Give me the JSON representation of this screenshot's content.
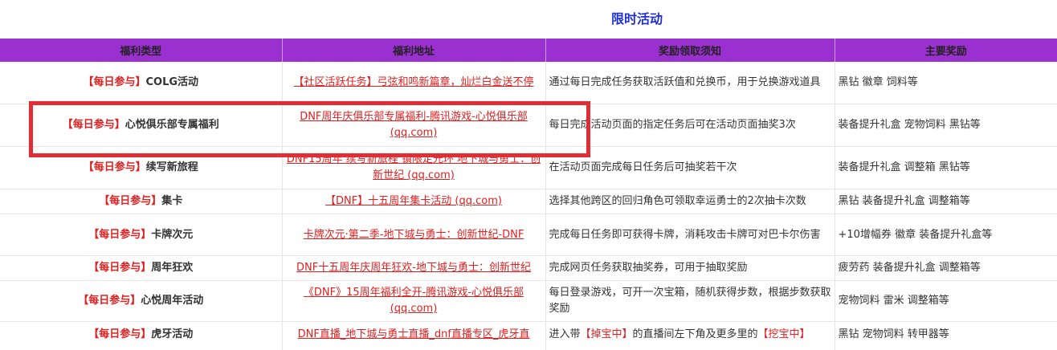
{
  "page": {
    "title": "限时活动"
  },
  "columns": [
    "福利类型",
    "福利地址",
    "奖励领取须知",
    "主要奖励"
  ],
  "rows": [
    {
      "tag": "【每日参与】",
      "type": "COLG活动",
      "link": "【社区活跃任务】弓弦和鸣新篇章，灿烂白金送不停",
      "notes": "通过每日完成任务获取活跃值和兑换币，用于兑换游戏道具",
      "rewards": "黑钻 徽章 饲料等"
    },
    {
      "tag": "【每日参与】",
      "type": "心悦俱乐部专属福利",
      "link": "DNF周年庆俱乐部专属福利-腾讯游戏-心悦俱乐部 (qq.com)",
      "notes": "每日完成活动页面的指定任务后可在活动页面抽奖3次",
      "rewards": "装备提升礼盒 宠物饲料 黑钻等"
    },
    {
      "tag": "【每日参与】",
      "type": "续写新旅程",
      "link": "DNF15周年 续写新旅程 镇限定光环 地下城与勇士：创新世纪 (qq.com)",
      "notes": "在活动页面完成每日任务后可抽奖若干次",
      "rewards": "装备提升礼盒 调整箱 黑钻等"
    },
    {
      "tag": "【每日参与】",
      "type": "集卡",
      "link": "【DNF】十五周年集卡活动 (qq.com)",
      "notes": "选择其他跨区的回归角色可领取幸运勇士的2次抽卡次数",
      "rewards": "黑钻 装备提升礼盒 调整箱等"
    },
    {
      "tag": "【每日参与】",
      "type": "卡牌次元",
      "link": "卡牌次元·第二季-地下城与勇士：创新世纪-DNF",
      "notes": "完成每日任务即可获得卡牌，消耗攻击卡牌可对巴卡尔伤害",
      "rewards": "+10增幅券 徽章 装备提升礼盒等"
    },
    {
      "tag": "【每日参与】",
      "type": "周年狂欢",
      "link": "DNF十五周年庆周年狂欢-地下城与勇士：创新世纪",
      "notes": "完成网页任务获取抽奖券，可用于抽取奖励",
      "rewards": "疲劳药 装备提升礼盒 调整箱等"
    },
    {
      "tag": "【每日参与】",
      "type": "心悦周年活动",
      "link": "《DNF》15周年福利全开-腾讯游戏-心悦俱乐部 (qq.com)",
      "notes": "每日登录游戏，可开一次宝箱，随机获得步数，根据步数获取奖励",
      "rewards": "宠物饲料 雷米 调整箱等"
    },
    {
      "tag": "【每日参与】",
      "type": "虎牙活动",
      "link": "DNF直播_地下城与勇士直播_dnf直播专区_虎牙直",
      "notes_pre": "进入带",
      "notes_hl1": "【掉宝中】",
      "notes_mid": "的直播间左下角及更多里的",
      "notes_hl2": "【挖宝中】",
      "rewards": "黑钻 宠物饲料 转甲器等"
    }
  ],
  "colors": {
    "header_bg": "#9b30d0",
    "caption": "#1e2fd8",
    "accent_red": "#e02020",
    "highlight_box": "#e32d35"
  }
}
